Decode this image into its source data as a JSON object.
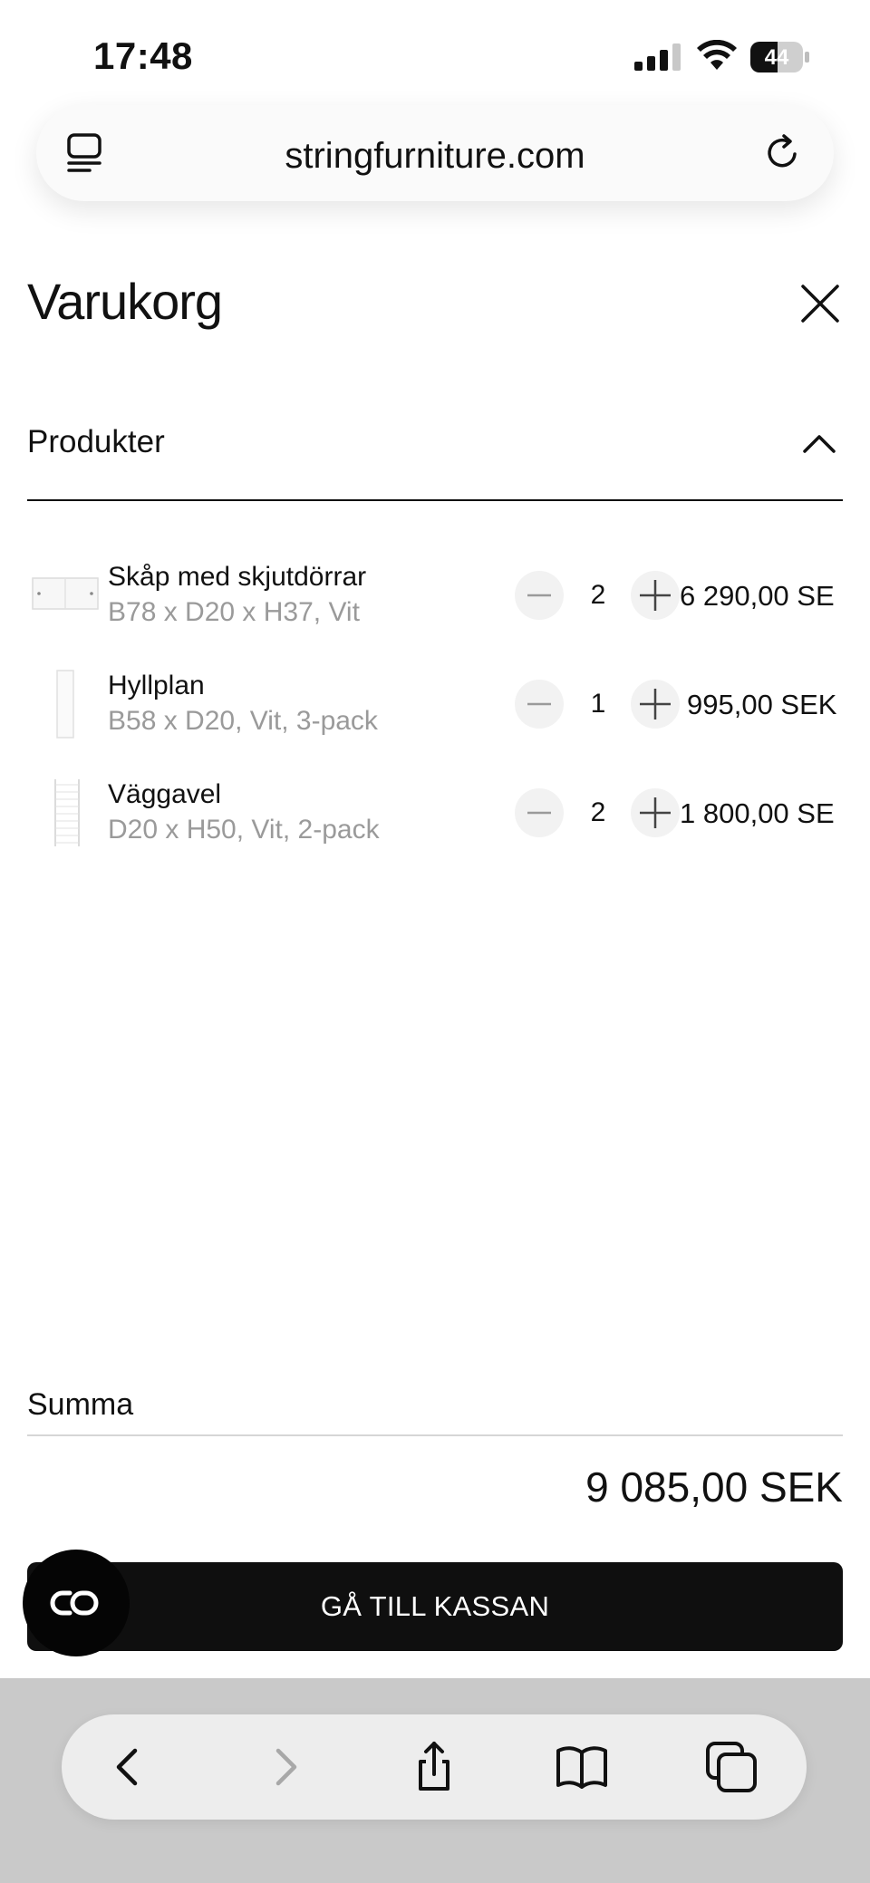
{
  "status_bar": {
    "time": "17:48",
    "battery": "44"
  },
  "browser": {
    "url": "stringfurniture.com"
  },
  "cart": {
    "title": "Varukorg",
    "section_label": "Produkter",
    "items": [
      {
        "name": "Skåp med skjutdörrar",
        "variant": "B78 x D20 x H37, Vit",
        "quantity": "2",
        "price": "6 290,00 SE"
      },
      {
        "name": "Hyllplan",
        "variant": "B58 x D20, Vit, 3-pack",
        "quantity": "1",
        "price": "995,00 SEK"
      },
      {
        "name": "Väggavel",
        "variant": "D20 x H50, Vit, 2-pack",
        "quantity": "2",
        "price": "1 800,00 SE"
      }
    ],
    "sum_label": "Summa",
    "sum_value": "9 085,00 SEK",
    "checkout_label": "GÅ TILL KASSAN"
  },
  "icons": {
    "close": "close-icon",
    "collapse": "chevron-up-icon",
    "minus": "minus-icon",
    "plus": "plus-icon",
    "chat": "chat-icon",
    "back": "back-icon",
    "forward": "forward-icon",
    "share": "share-icon",
    "bookmarks": "bookmarks-icon",
    "tabs": "tabs-icon",
    "reload": "reload-icon"
  },
  "colors": {
    "checkout_bg": "#0f0f0f",
    "muted_text": "#9a9a9a",
    "toolbar_bg": "#ededed"
  }
}
